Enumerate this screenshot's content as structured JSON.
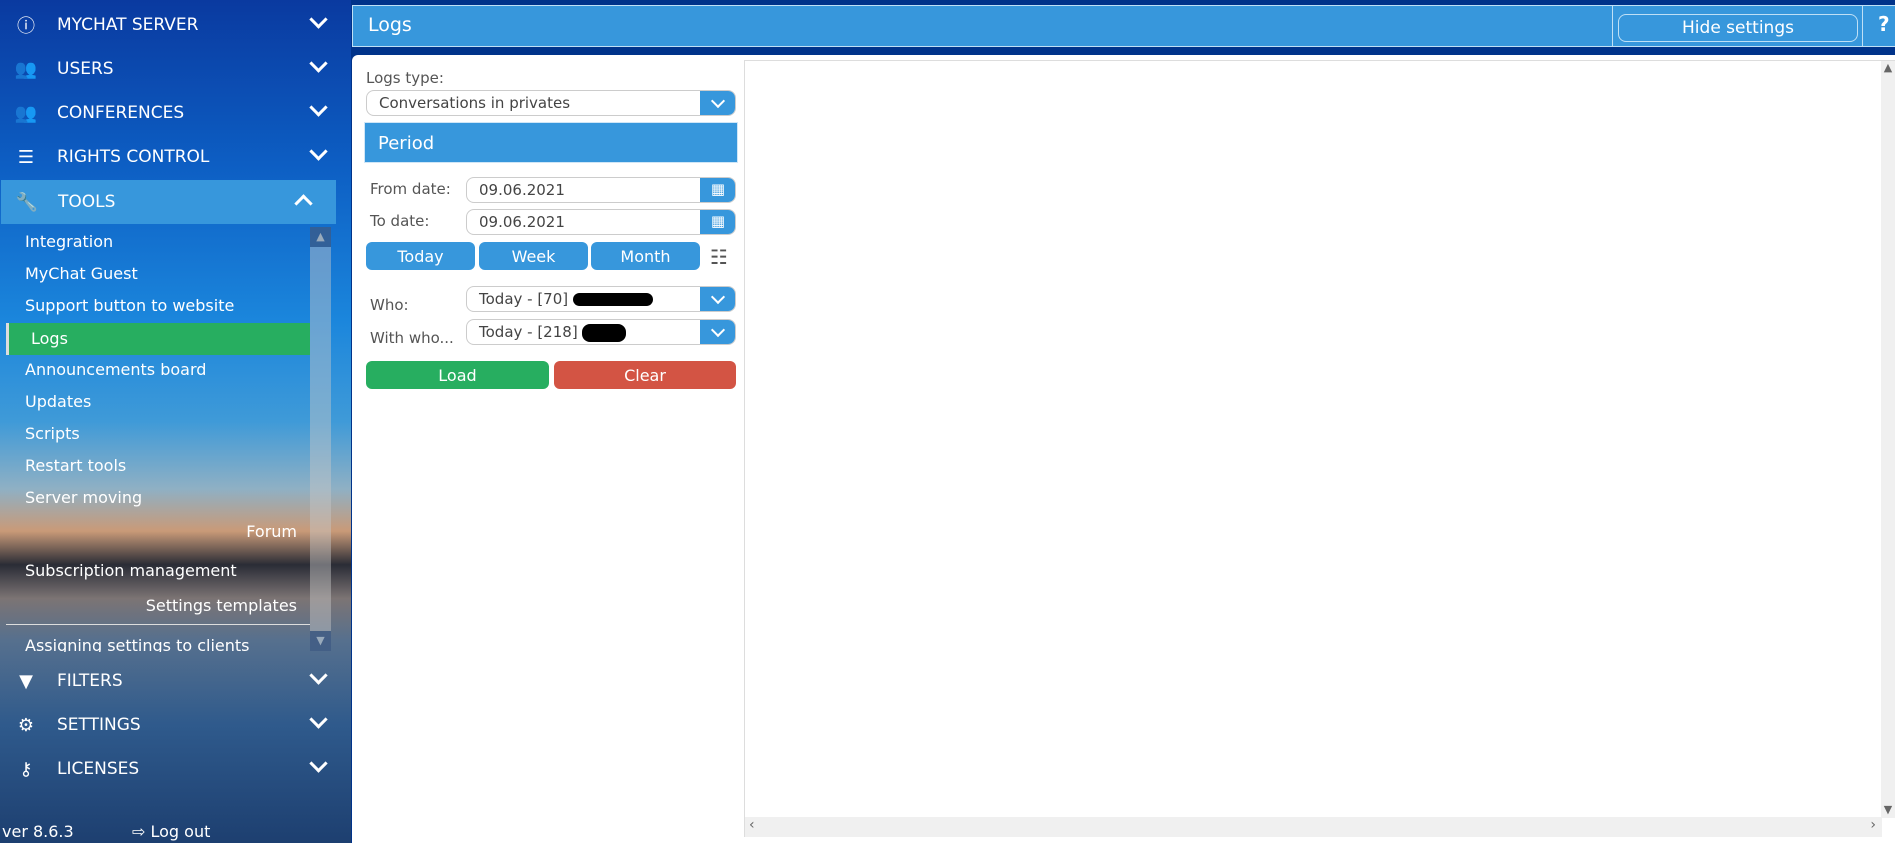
{
  "sidebar": {
    "sections_top": [
      {
        "label": "MYCHAT SERVER",
        "icon": "info-icon"
      },
      {
        "label": "USERS",
        "icon": "users-icon"
      },
      {
        "label": "CONFERENCES",
        "icon": "conferences-icon"
      },
      {
        "label": "RIGHTS CONTROL",
        "icon": "list-icon"
      },
      {
        "label": "TOOLS",
        "icon": "wrench-icon",
        "expanded": true
      }
    ],
    "tools_items": [
      "Integration",
      "MyChat Guest",
      "Support button to website",
      "Logs",
      "Announcements board",
      "Updates",
      "Scripts",
      "Restart tools",
      "Server moving",
      "Forum",
      "Subscription management",
      "Settings templates",
      "Assigning settings to clients"
    ],
    "selected_item": "Logs",
    "sections_bottom": [
      {
        "label": "FILTERS",
        "icon": "filter-icon"
      },
      {
        "label": "SETTINGS",
        "icon": "gears-icon"
      },
      {
        "label": "LICENSES",
        "icon": "key-icon"
      }
    ],
    "version": "ver 8.6.3",
    "logout": "Log out"
  },
  "header": {
    "title": "Logs",
    "hide_settings": "Hide settings",
    "help": "?"
  },
  "form": {
    "logs_type_label": "Logs type:",
    "logs_type_value": "Conversations in privates",
    "period_title": "Period",
    "from_label": "From date:",
    "from_value": "09.06.2021",
    "to_label": "To date:",
    "to_value": "09.06.2021",
    "today": "Today",
    "week": "Week",
    "month": "Month",
    "who_label": "Who:",
    "who_value": "Today - [70]",
    "with_label": "With who...",
    "with_value": "Today - [218]",
    "load": "Load",
    "clear": "Clear"
  },
  "colors": {
    "accent": "#3797dc",
    "load": "#27ae60",
    "clear": "#d35444",
    "selected": "#27ae60"
  }
}
